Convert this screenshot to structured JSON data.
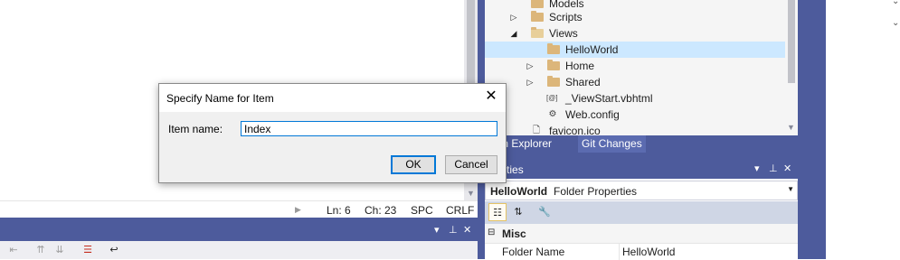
{
  "status_bar": {
    "line": "Ln: 6",
    "col": "Ch: 23",
    "whitespace": "SPC",
    "line_ending": "CRLF"
  },
  "solution_explorer": {
    "items": [
      {
        "label": "Models",
        "icon": "folder-icon",
        "expander": ""
      },
      {
        "label": "Scripts",
        "icon": "folder-icon",
        "expander": "▷"
      },
      {
        "label": "Views",
        "icon": "folder-open-icon",
        "expander": "◢"
      },
      {
        "label": "HelloWorld",
        "icon": "folder-icon",
        "expander": "",
        "selected": true
      },
      {
        "label": "Home",
        "icon": "folder-icon",
        "expander": "▷"
      },
      {
        "label": "Shared",
        "icon": "folder-icon",
        "expander": "▷"
      },
      {
        "label": "_ViewStart.vbhtml",
        "icon": "razor-file-icon",
        "expander": ""
      },
      {
        "label": "Web.config",
        "icon": "config-file-icon",
        "expander": ""
      },
      {
        "label": "favicon.ico",
        "icon": "file-icon",
        "expander": ""
      }
    ],
    "tabs": [
      "ution Explorer",
      "Git Changes"
    ]
  },
  "properties": {
    "title": "operties",
    "object_name": "HelloWorld",
    "object_type": "Folder Properties",
    "category": "Misc",
    "rows": [
      {
        "name": "Folder Name",
        "value": "HelloWorld"
      }
    ]
  },
  "dialog": {
    "title": "Specify Name for Item",
    "item_label": "Item name:",
    "item_value": "Index",
    "ok_label": "OK",
    "cancel_label": "Cancel"
  },
  "colors": {
    "accent": "#4d5b9c",
    "selection": "#cce8ff",
    "focus_border": "#0078d7"
  }
}
